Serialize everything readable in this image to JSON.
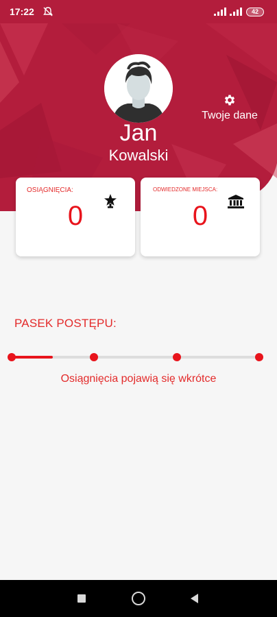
{
  "status_bar": {
    "time": "17:22",
    "battery": "42",
    "icons": [
      "mute-icon",
      "signal-icon",
      "signal-icon",
      "battery-icon"
    ]
  },
  "profile": {
    "first_name": "Jan",
    "last_name": "Kowalski",
    "avatar_icon": "person-avatar-icon",
    "details_button_label": "Twoje dane",
    "details_button_icon": "gear-icon"
  },
  "stats": {
    "achievements": {
      "label": "OSIĄGNIĘCIA:",
      "value": "0",
      "icon": "trophy-star-icon"
    },
    "places": {
      "label": "ODWIEDZONE MIEJSCA:",
      "value": "0",
      "icon": "museum-icon"
    }
  },
  "progress": {
    "title": "PASEK POSTĘPU:",
    "fill_fraction": 0.165,
    "milestones": [
      0,
      0.333,
      0.667,
      1
    ],
    "note": "Osiągnięcia pojawią się wkrótce"
  },
  "nav_bar": {
    "buttons": [
      "recent-apps-icon",
      "home-icon",
      "back-icon"
    ]
  },
  "colors": {
    "header_red": "#b31d3c",
    "accent_red": "#e8141c",
    "text_red": "#e32a2a",
    "background": "#f6f6f6"
  }
}
